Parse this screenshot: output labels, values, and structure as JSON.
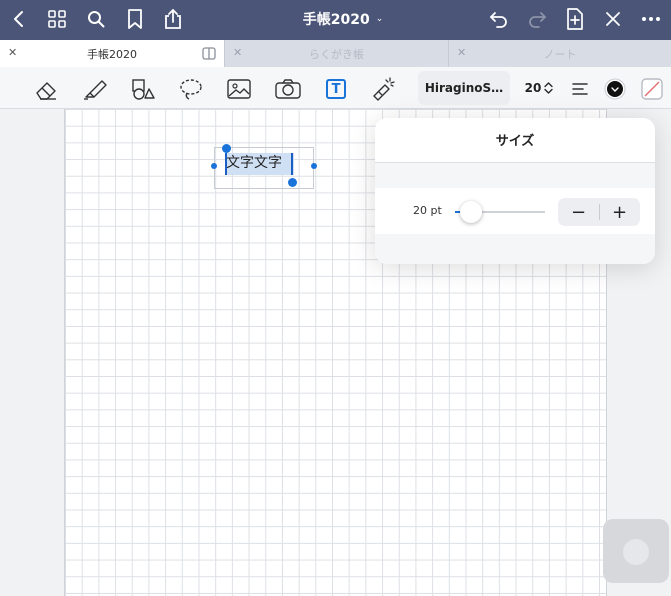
{
  "topbar": {
    "title": "手帳2020",
    "left_icons": [
      "back-chevron-icon",
      "grid-icon",
      "search-icon",
      "bookmark-icon",
      "share-icon"
    ],
    "right_icons": [
      "undo-icon",
      "redo-icon",
      "add-page-icon",
      "pen-off-icon",
      "more-icon"
    ]
  },
  "tabs": [
    {
      "label": "手帳2020",
      "active": true
    },
    {
      "label": "らくがき帳",
      "active": false
    },
    {
      "label": "ノート",
      "active": false
    }
  ],
  "toolbar": {
    "tools": [
      "eraser-icon",
      "highlighter-icon",
      "shapes-icon",
      "lasso-icon",
      "image-icon",
      "camera-icon",
      "text-tool-icon",
      "laser-pointer-icon"
    ],
    "text_tool_glyph": "T",
    "font_name": "HiraginoS…",
    "font_size": "20",
    "color_black": "#111111"
  },
  "text_box": {
    "content": "文字文字"
  },
  "size_popover": {
    "title": "サイズ",
    "size_label": "20 pt",
    "slider_fraction": 0.18,
    "minus_label": "−",
    "plus_label": "+"
  },
  "colors": {
    "topbar": "#4a5577",
    "accent": "#1a73d9"
  }
}
